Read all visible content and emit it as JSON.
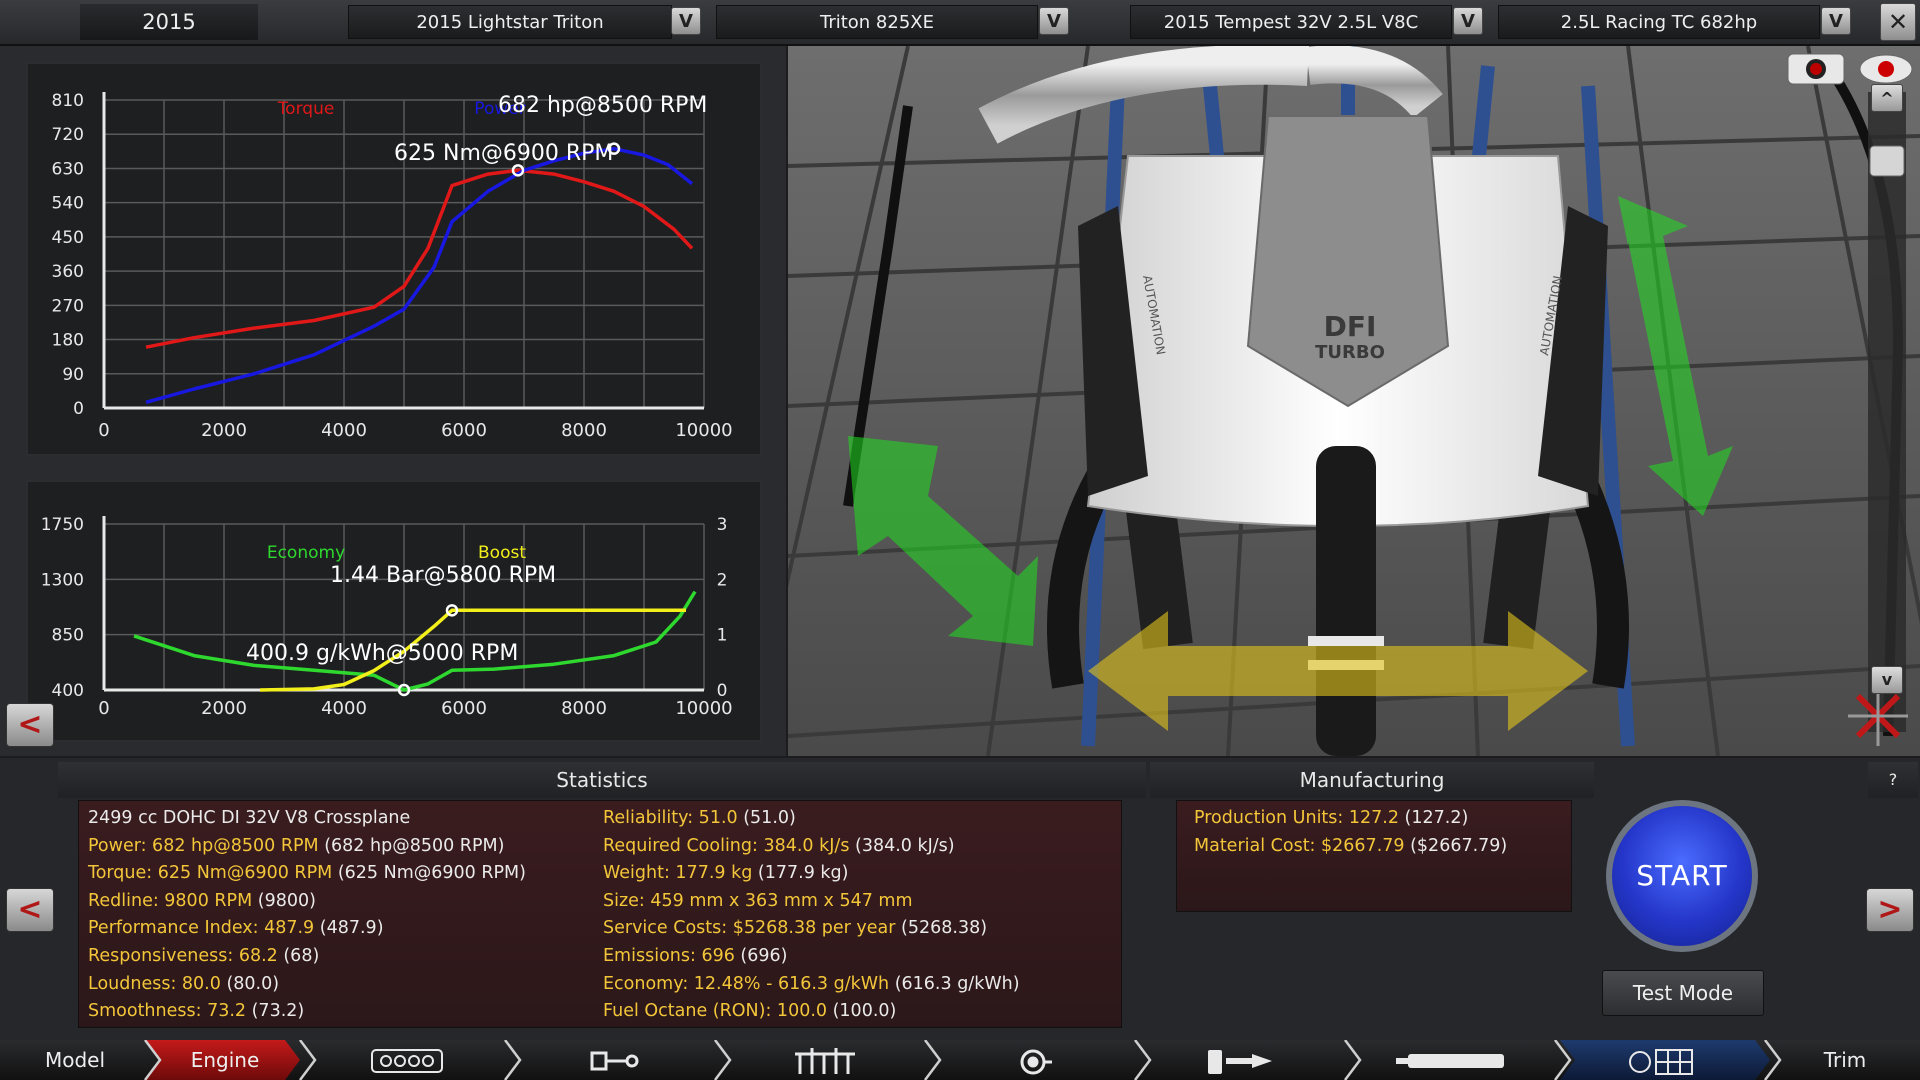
{
  "topbar": {
    "year": "2015",
    "selectors": [
      {
        "value": "2015 Lightstar Triton"
      },
      {
        "value": "Triton 825XE"
      },
      {
        "value": "2015 Tempest 32V 2.5L V8C"
      },
      {
        "value": "2.5L Racing TC 682hp"
      }
    ],
    "dropdown_glyph": "V",
    "close_glyph": "✕"
  },
  "chart_data": [
    {
      "type": "line",
      "xlim": [
        0,
        10000
      ],
      "ylim": [
        0,
        810
      ],
      "x_ticks": [
        "0",
        "2000",
        "4000",
        "6000",
        "8000",
        "10000"
      ],
      "y_ticks": [
        "0",
        "90",
        "180",
        "270",
        "360",
        "450",
        "540",
        "630",
        "720",
        "810"
      ],
      "legend": [
        "Torque",
        "Power"
      ],
      "series": [
        {
          "name": "Torque",
          "color": "#e01818",
          "points": [
            [
              700,
              160
            ],
            [
              1500,
              185
            ],
            [
              2500,
              210
            ],
            [
              3500,
              230
            ],
            [
              4500,
              265
            ],
            [
              5000,
              320
            ],
            [
              5400,
              420
            ],
            [
              5800,
              585
            ],
            [
              6400,
              615
            ],
            [
              6900,
              625
            ],
            [
              7500,
              615
            ],
            [
              8000,
              595
            ],
            [
              8500,
              570
            ],
            [
              9000,
              530
            ],
            [
              9500,
              470
            ],
            [
              9800,
              420
            ]
          ]
        },
        {
          "name": "Power",
          "color": "#1818e0",
          "points": [
            [
              700,
              15
            ],
            [
              1500,
              50
            ],
            [
              2500,
              90
            ],
            [
              3500,
              140
            ],
            [
              4500,
              215
            ],
            [
              5000,
              260
            ],
            [
              5500,
              370
            ],
            [
              5800,
              490
            ],
            [
              6400,
              570
            ],
            [
              7000,
              625
            ],
            [
              7500,
              650
            ],
            [
              8000,
              670
            ],
            [
              8500,
              682
            ],
            [
              9000,
              665
            ],
            [
              9400,
              640
            ],
            [
              9800,
              590
            ]
          ]
        }
      ],
      "annotations": [
        {
          "text": "682 hp@8500 RPM",
          "x": 8500,
          "y": 682
        },
        {
          "text": "625 Nm@6900 RPM",
          "x": 6900,
          "y": 625
        }
      ]
    },
    {
      "type": "line",
      "xlim": [
        0,
        10000
      ],
      "ylim": [
        400,
        1750
      ],
      "y2lim": [
        0,
        3
      ],
      "x_ticks": [
        "0",
        "2000",
        "4000",
        "6000",
        "8000",
        "10000"
      ],
      "y_ticks": [
        "400",
        "850",
        "1300",
        "1750"
      ],
      "y2_ticks": [
        "0",
        "1",
        "2",
        "3"
      ],
      "legend": [
        "Economy",
        "Boost"
      ],
      "series": [
        {
          "name": "Economy",
          "color": "#2ed82e",
          "axis": "left",
          "points": [
            [
              500,
              840
            ],
            [
              1500,
              680
            ],
            [
              2500,
              600
            ],
            [
              3500,
              560
            ],
            [
              4500,
              520
            ],
            [
              5000,
              400
            ],
            [
              5400,
              450
            ],
            [
              5800,
              560
            ],
            [
              6500,
              570
            ],
            [
              7500,
              610
            ],
            [
              8500,
              680
            ],
            [
              9200,
              790
            ],
            [
              9600,
              1000
            ],
            [
              9850,
              1200
            ]
          ]
        },
        {
          "name": "Boost",
          "color": "#f2ef1a",
          "axis": "right",
          "points": [
            [
              2600,
              0.0
            ],
            [
              3500,
              0.02
            ],
            [
              4000,
              0.1
            ],
            [
              4500,
              0.35
            ],
            [
              5000,
              0.7
            ],
            [
              5500,
              1.15
            ],
            [
              5800,
              1.44
            ],
            [
              9700,
              1.44
            ]
          ]
        }
      ],
      "annotations": [
        {
          "text": "1.44 Bar@5800 RPM",
          "x": 5800,
          "y": 1.44,
          "axis": "right"
        },
        {
          "text": "400.9 g/kWh@5000 RPM",
          "x": 5000,
          "y": 400,
          "axis": "left"
        }
      ]
    }
  ],
  "statistics": {
    "title": "Statistics",
    "left": [
      {
        "label": "2499 cc DOHC DI 32V V8 Crossplane",
        "value": "",
        "white": true
      },
      {
        "label": "Power: 682 hp@8500 RPM",
        "value": "(682 hp@8500 RPM)"
      },
      {
        "label": "Torque: 625 Nm@6900 RPM",
        "value": "(625 Nm@6900 RPM)"
      },
      {
        "label": "Redline: 9800 RPM",
        "value": "(9800)"
      },
      {
        "label": "Performance Index: 487.9",
        "value": "(487.9)"
      },
      {
        "label": "Responsiveness: 68.2",
        "value": "(68)"
      },
      {
        "label": "Loudness: 80.0",
        "value": "(80.0)"
      },
      {
        "label": "Smoothness: 73.2",
        "value": "(73.2)"
      }
    ],
    "right": [
      {
        "label": "Reliability: 51.0",
        "value": "(51.0)"
      },
      {
        "label": "Required Cooling: 384.0 kJ/s",
        "value": "(384.0 kJ/s)"
      },
      {
        "label": "Weight: 177.9 kg",
        "value": "(177.9 kg)"
      },
      {
        "label": "Size: 459 mm x 363 mm x 547 mm",
        "value": ""
      },
      {
        "label": "Service Costs: $5268.38 per year",
        "value": "(5268.38)"
      },
      {
        "label": "Emissions: 696",
        "value": "(696)"
      },
      {
        "label": "Economy: 12.48% - 616.3 g/kWh",
        "value": "(616.3 g/kWh)"
      },
      {
        "label": "Fuel Octane (RON): 100.0",
        "value": "(100.0)"
      }
    ]
  },
  "manufacturing": {
    "title": "Manufacturing",
    "lines": [
      {
        "label": "Production Units: 127.2",
        "value": "(127.2)"
      },
      {
        "label": "Material Cost: $2667.79",
        "value": "($2667.79)"
      }
    ]
  },
  "help_label": "?",
  "start_label": "START",
  "test_mode_label": "Test Mode",
  "nav_prev": "<",
  "nav_next": ">",
  "scroll_up": "^",
  "scroll_down": "v",
  "bottom_nav": {
    "model": "Model",
    "engine": "Engine",
    "trim": "Trim",
    "icons": [
      "engine-block-icon",
      "crank-rod-icon",
      "cylinder-head-icon",
      "turbo-icon",
      "fuel-system-icon",
      "exhaust-icon",
      "engine-tune-icon"
    ]
  },
  "engine_badge": {
    "line1": "DFI",
    "line2": "TURBO",
    "side_text": "AUTOMATION"
  },
  "colors": {
    "torque": "#e01818",
    "power": "#1818e0",
    "economy": "#2ed82e",
    "boost": "#f2ef1a",
    "stat_text": "#f3c63a",
    "start_blue": "#2436c9"
  }
}
